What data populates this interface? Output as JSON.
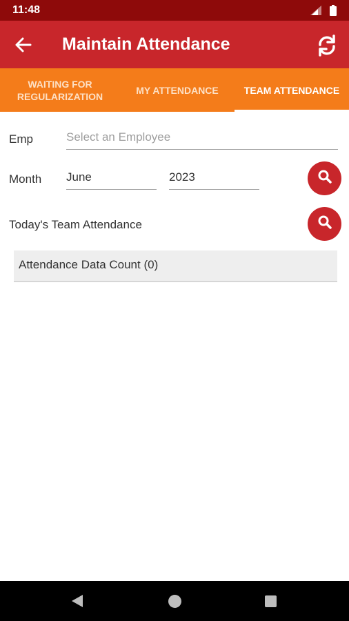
{
  "status_bar": {
    "time": "11:48"
  },
  "app_bar": {
    "title": "Maintain Attendance"
  },
  "tabs": [
    {
      "label_line1": "WAITING FOR",
      "label_line2": "REGULARIZATION",
      "active": false
    },
    {
      "label_line1": "MY ATTENDANCE",
      "label_line2": "",
      "active": false
    },
    {
      "label_line1": "TEAM ATTENDANCE",
      "label_line2": "",
      "active": true
    }
  ],
  "form": {
    "emp_label": "Emp",
    "emp_placeholder": "Select an Employee",
    "month_label": "Month",
    "month_value": "June",
    "year_value": "2023",
    "today_label": "Today's Team Attendance"
  },
  "result": {
    "count_text": "Attendance Data Count (0)"
  },
  "colors": {
    "primary": "#c8262b",
    "accent": "#f47c1a",
    "status": "#8e0a0a"
  }
}
